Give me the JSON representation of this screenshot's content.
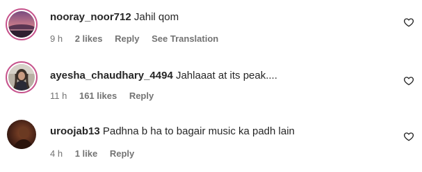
{
  "comments": [
    {
      "username": "nooray_noor712",
      "text": "Jahil qom",
      "time": "9 h",
      "likes": "2 likes",
      "reply": "Reply",
      "translate": "See Translation"
    },
    {
      "username": "ayesha_chaudhary_4494",
      "text": "Jahlaaat at its peak....",
      "time": "11 h",
      "likes": "161 likes",
      "reply": "Reply"
    },
    {
      "username": "uroojab13",
      "text": "Padhna b ha to bagair music ka padh lain",
      "time": "4 h",
      "likes": "1 like",
      "reply": "Reply"
    }
  ],
  "colors": {
    "text": "#262626",
    "meta": "#737373",
    "story_ring": "#c6538c"
  },
  "icons": {
    "like": "heart-outline-icon"
  }
}
